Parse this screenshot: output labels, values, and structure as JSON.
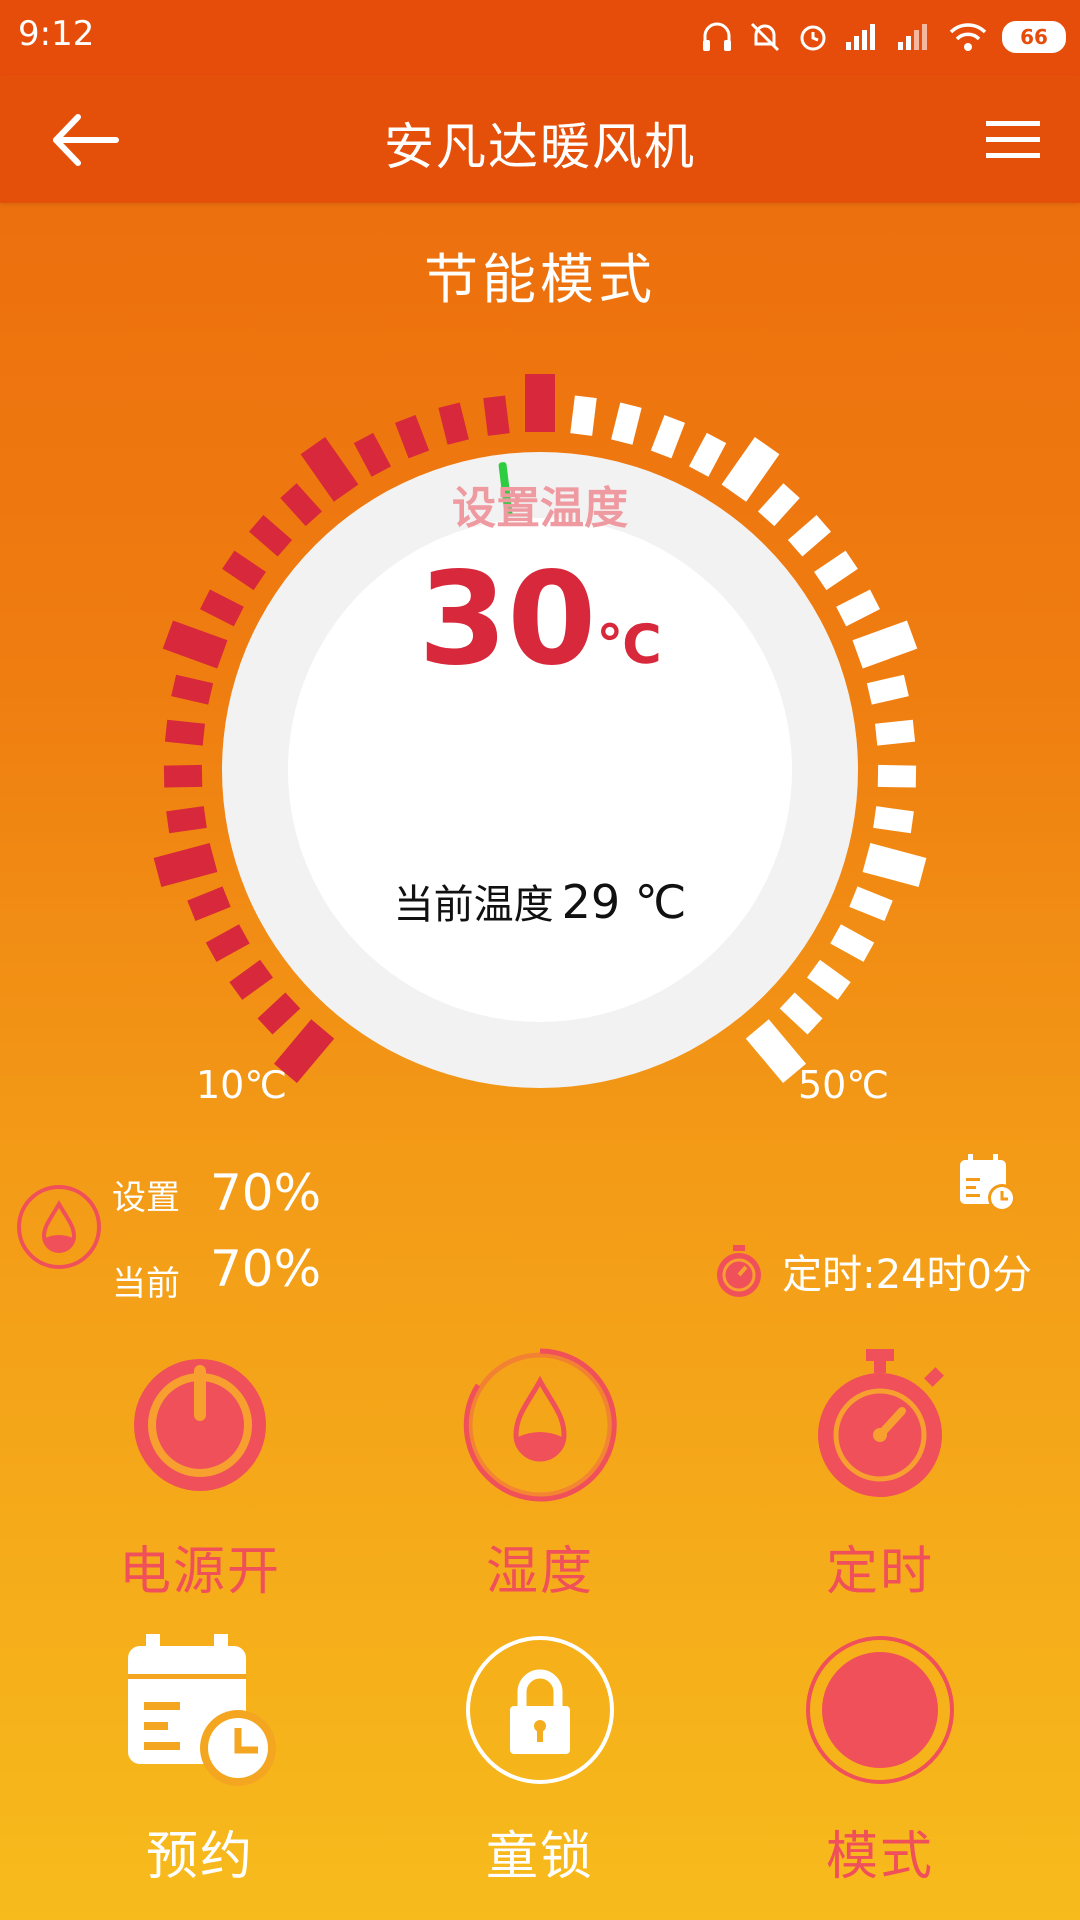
{
  "status": {
    "time": "9:12",
    "battery": "66"
  },
  "appbar": {
    "title": "安凡达暖风机"
  },
  "mode_title": "节能模式",
  "thermostat": {
    "set_label": "设置温度",
    "set_value": "30",
    "set_unit": "℃",
    "current_label": "当前温度",
    "current_value": "29 ℃",
    "min_label": "10℃",
    "max_label": "50℃"
  },
  "humidity": {
    "set_label": "设置",
    "set_value": "70%",
    "current_label": "当前",
    "current_value": "70%"
  },
  "timer": {
    "text": "定时:24时0分"
  },
  "controls": {
    "power": "电源开",
    "humidity": "湿度",
    "timer": "定时",
    "schedule": "预约",
    "child_lock": "童锁",
    "mode": "模式"
  },
  "colors": {
    "header": "#e4500a",
    "accent_red": "#d8283b",
    "control_red": "#f0505a",
    "indicator_green": "#2ecc40"
  }
}
